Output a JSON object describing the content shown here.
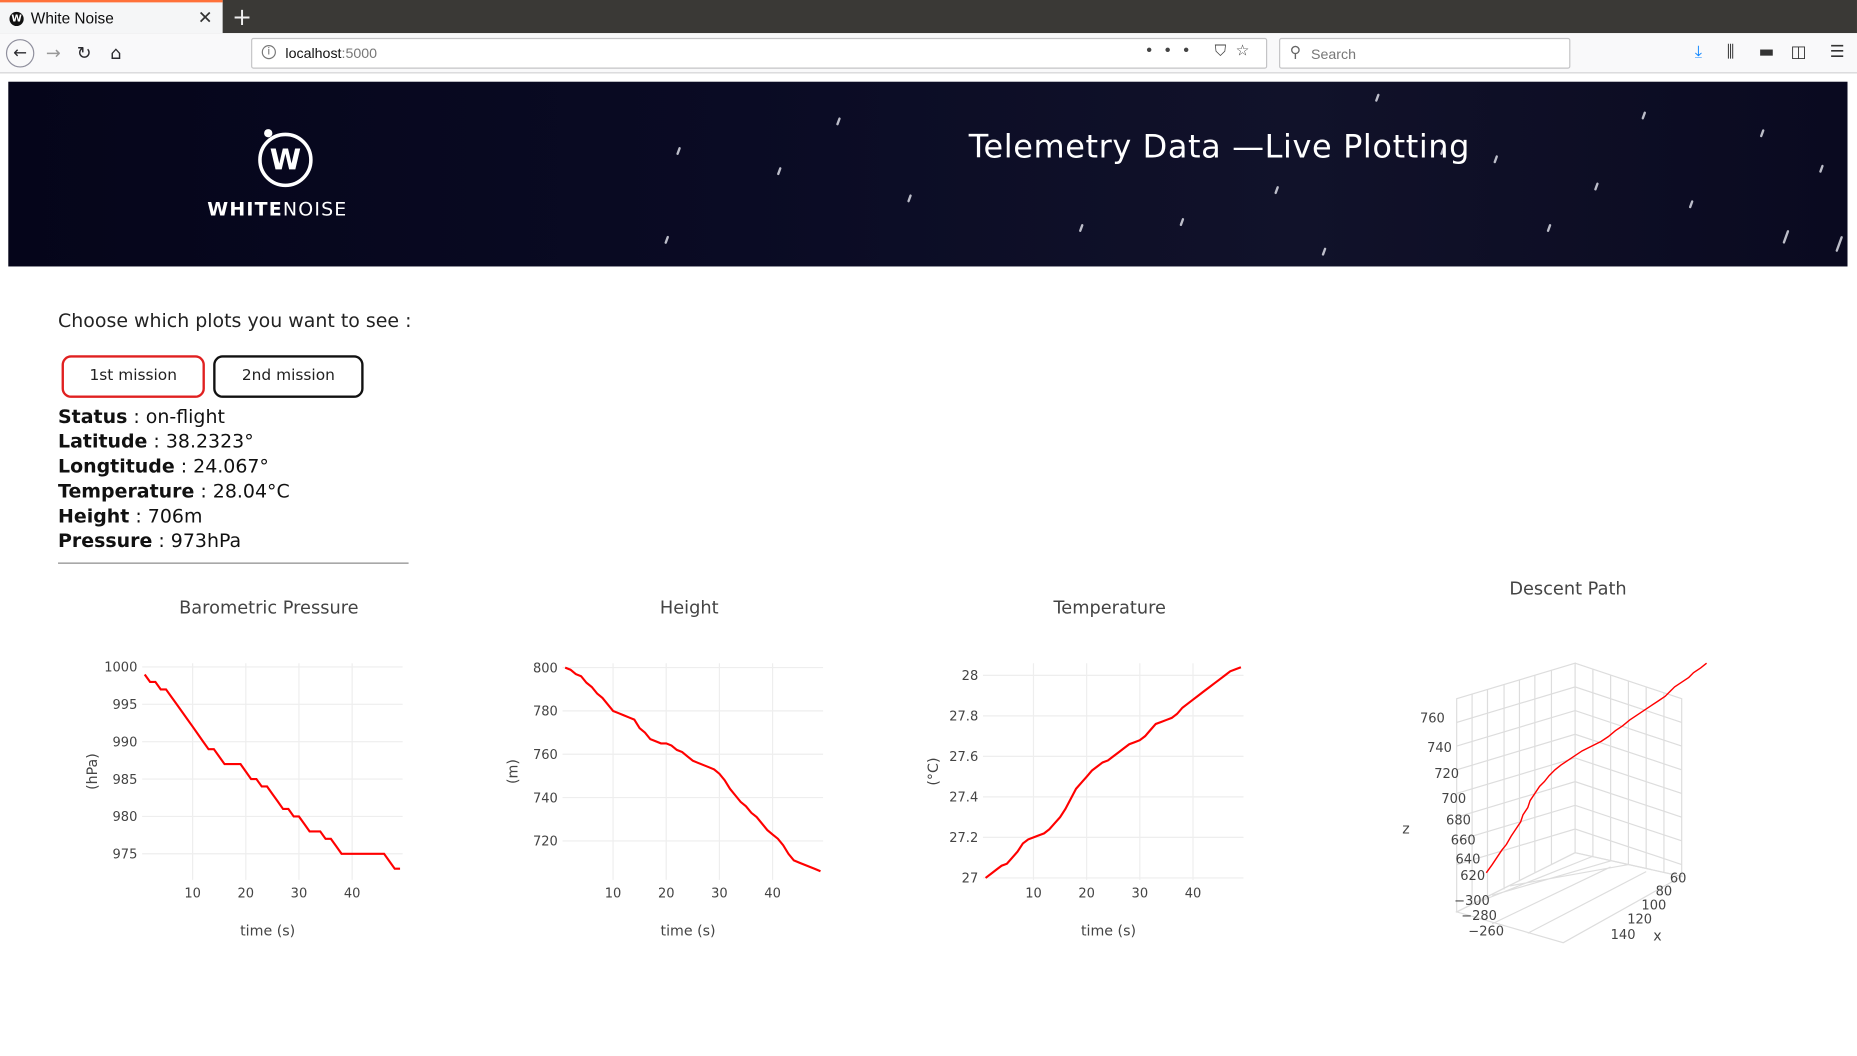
{
  "browser": {
    "tab_title": "White Noise",
    "favicon": "W",
    "url_host": "localhost",
    "url_port": ":5000",
    "search_placeholder": "Search"
  },
  "banner": {
    "logo_letter": "W",
    "logo_text_bold": "WHITE",
    "logo_text_light": "NOISE",
    "title": "Telemetry Data —Live Plotting"
  },
  "controls": {
    "prompt": "Choose which plots you want to see :",
    "mission1": "1st mission",
    "mission2": "2nd mission"
  },
  "status": {
    "status_label": "Status",
    "status_value": " : on-flight",
    "lat_label": "Latitude",
    "lat_value": " : 38.2323°",
    "lon_label": "Longtitude",
    "lon_value": " : 24.067°",
    "temp_label": "Temperature",
    "temp_value": " : 28.04°C",
    "height_label": "Height",
    "height_value": " : 706m",
    "pressure_label": "Pressure",
    "pressure_value": " : 973hPa"
  },
  "colors": {
    "accent": "#e02020",
    "line": "#ff0000",
    "banner_bg": "#0a0b24"
  },
  "chart_data": [
    {
      "type": "line",
      "title": "Barometric Pressure",
      "xlabel": "time (s)",
      "ylabel": "(hPa)",
      "x": [
        1,
        2,
        3,
        4,
        5,
        6,
        7,
        8,
        9,
        10,
        11,
        12,
        13,
        14,
        15,
        16,
        17,
        18,
        19,
        20,
        21,
        22,
        23,
        24,
        25,
        26,
        27,
        28,
        29,
        30,
        31,
        32,
        33,
        34,
        35,
        36,
        37,
        38,
        39,
        40,
        41,
        42,
        43,
        44,
        45,
        46,
        47,
        48,
        49
      ],
      "y": [
        999,
        998,
        998,
        997,
        997,
        996,
        995,
        994,
        993,
        992,
        991,
        990,
        989,
        989,
        988,
        987,
        987,
        987,
        987,
        986,
        985,
        985,
        984,
        984,
        983,
        982,
        981,
        981,
        980,
        980,
        979,
        978,
        978,
        978,
        977,
        977,
        976,
        975,
        975,
        975,
        975,
        975,
        975,
        975,
        975,
        975,
        974,
        973,
        973
      ],
      "xlim": [
        0.5,
        49.5
      ],
      "ylim": [
        971.5,
        1000.5
      ],
      "xticks": [
        10,
        20,
        30,
        40
      ],
      "yticks": [
        975,
        980,
        985,
        990,
        995,
        1000
      ]
    },
    {
      "type": "line",
      "title": "Height",
      "xlabel": "time (s)",
      "ylabel": "(m)",
      "x": [
        1,
        2,
        3,
        4,
        5,
        6,
        7,
        8,
        9,
        10,
        11,
        12,
        13,
        14,
        15,
        16,
        17,
        18,
        19,
        20,
        21,
        22,
        23,
        24,
        25,
        26,
        27,
        28,
        29,
        30,
        31,
        32,
        33,
        34,
        35,
        36,
        37,
        38,
        39,
        40,
        41,
        42,
        43,
        44,
        45,
        46,
        47,
        48,
        49
      ],
      "y": [
        800,
        799,
        797,
        796,
        793,
        791,
        788,
        786,
        783,
        780,
        779,
        778,
        777,
        776,
        772,
        770,
        767,
        766,
        765,
        765,
        764,
        762,
        761,
        759,
        757,
        756,
        755,
        754,
        753,
        751,
        748,
        744,
        741,
        738,
        736,
        733,
        731,
        728,
        725,
        723,
        721,
        718,
        714,
        711,
        710,
        709,
        708,
        707,
        706
      ],
      "xlim": [
        0.5,
        49.5
      ],
      "ylim": [
        702,
        802
      ],
      "xticks": [
        10,
        20,
        30,
        40
      ],
      "yticks": [
        720,
        740,
        760,
        780,
        800
      ]
    },
    {
      "type": "line",
      "title": "Temperature",
      "xlabel": "time (s)",
      "ylabel": "(°C)",
      "x": [
        1,
        2,
        3,
        4,
        5,
        6,
        7,
        8,
        9,
        10,
        11,
        12,
        13,
        14,
        15,
        16,
        17,
        18,
        19,
        20,
        21,
        22,
        23,
        24,
        25,
        26,
        27,
        28,
        29,
        30,
        31,
        32,
        33,
        34,
        35,
        36,
        37,
        38,
        39,
        40,
        41,
        42,
        43,
        44,
        45,
        46,
        47,
        48,
        49
      ],
      "y": [
        27.0,
        27.02,
        27.04,
        27.06,
        27.07,
        27.1,
        27.13,
        27.17,
        27.19,
        27.2,
        27.21,
        27.22,
        27.24,
        27.27,
        27.3,
        27.34,
        27.39,
        27.44,
        27.47,
        27.5,
        27.53,
        27.55,
        27.57,
        27.58,
        27.6,
        27.62,
        27.64,
        27.66,
        27.67,
        27.68,
        27.7,
        27.73,
        27.76,
        27.77,
        27.78,
        27.79,
        27.81,
        27.84,
        27.86,
        27.88,
        27.9,
        27.92,
        27.94,
        27.96,
        27.98,
        28.0,
        28.02,
        28.03,
        28.04
      ],
      "xlim": [
        0.5,
        49.5
      ],
      "ylim": [
        26.99,
        28.06
      ],
      "xticks": [
        10,
        20,
        30,
        40
      ],
      "yticks": [
        27,
        27.2,
        27.4,
        27.6,
        27.8,
        28
      ]
    },
    {
      "type": "scatter",
      "title": "Descent Path",
      "z_axis_label": "z",
      "x_axis_label": "x",
      "z_ticks": [
        "760",
        "740",
        "720",
        "700",
        "680",
        "660",
        "640",
        "620"
      ],
      "y_ticks": [
        "−300",
        "−280",
        "−260"
      ],
      "x_ticks": [
        "60",
        "80",
        "100",
        "120",
        "140"
      ]
    }
  ]
}
